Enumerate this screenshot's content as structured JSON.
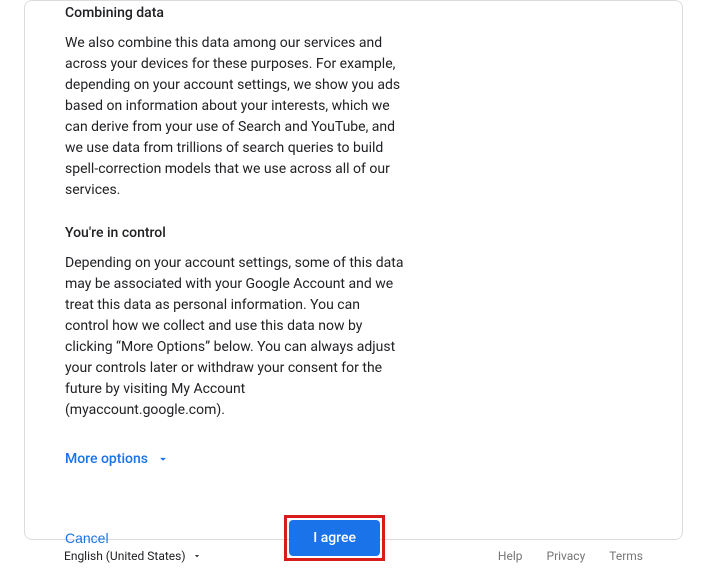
{
  "sections": [
    {
      "heading": "Combining data",
      "body": "We also combine this data among our services and across your devices for these purposes. For example, depending on your account settings, we show you ads based on information about your interests, which we can derive from your use of Search and YouTube, and we use data from trillions of search queries to build spell-correction models that we use across all of our services."
    },
    {
      "heading": "You're in control",
      "body": "Depending on your account settings, some of this data may be associated with your Google Account and we treat this data as personal information. You can control how we collect and use this data now by clicking “More Options” below. You can always adjust your controls later or withdraw your consent for the future by visiting My Account (myaccount.google.com)."
    }
  ],
  "moreOptions": "More options",
  "actions": {
    "cancel": "Cancel",
    "agree": "I agree"
  },
  "footer": {
    "language": "English (United States)",
    "links": {
      "help": "Help",
      "privacy": "Privacy",
      "terms": "Terms"
    }
  },
  "colors": {
    "link": "#1a73e8",
    "highlight": "#d81b1b"
  }
}
